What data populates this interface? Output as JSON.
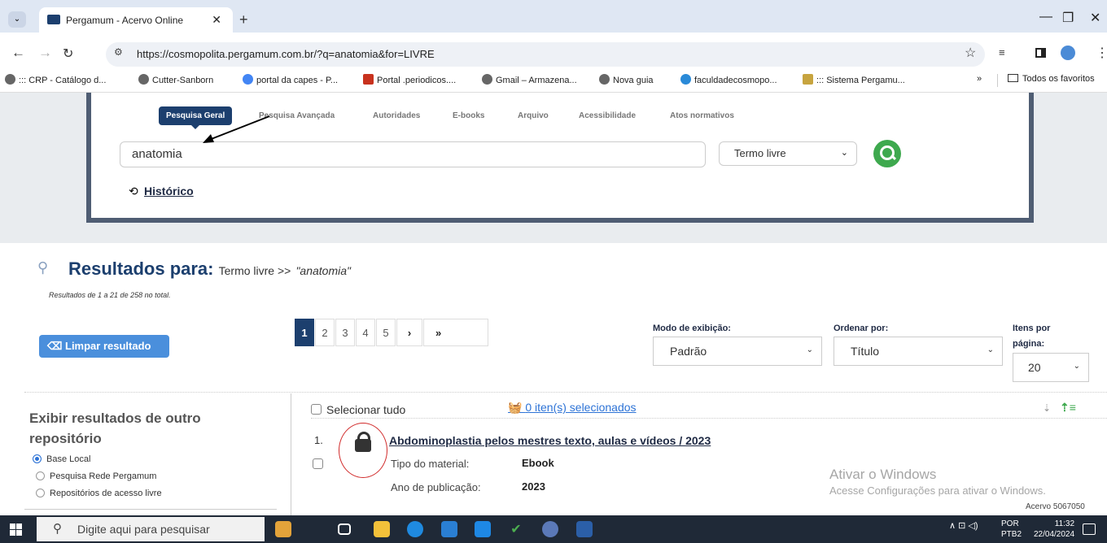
{
  "browser": {
    "tab_title": "Pergamum - Acervo Online",
    "tab_close": "✕",
    "new_tab": "+",
    "url": "https://cosmopolita.pergamum.com.br/?q=anatomia&for=LIVRE",
    "bookmarks": [
      "::: CRP - Catálogo d...",
      "Cutter-Sanborn",
      "portal da capes - P...",
      "Portal .periodicos....",
      "Gmail – Armazena...",
      "Nova guia",
      "faculdadecosmopo...",
      "::: Sistema Pergamu..."
    ],
    "bookmarks_overflow": "»",
    "all_bookmarks": "Todos os favoritos"
  },
  "search": {
    "tabs": [
      "Pesquisa Geral",
      "Pesquisa Avançada",
      "Autoridades",
      "E-books",
      "Arquivo",
      "Acessibilidade",
      "Atos normativos"
    ],
    "query": "anatomia",
    "term_select": "Termo livre",
    "history": "Histórico"
  },
  "results": {
    "heading": "Resultados para:",
    "term_label": "Termo livre >>",
    "term_query": "\"anatomia\"",
    "count_text": "Resultados de 1 a 21 de 258 no total.",
    "clear_button": "Limpar resultado",
    "pages": [
      "1",
      "2",
      "3",
      "4",
      "5",
      "›",
      "»"
    ],
    "display_mode_label": "Modo de exibição:",
    "display_mode": "Padrão",
    "order_label": "Ordenar por:",
    "order": "Título",
    "per_page_label1": "Itens por",
    "per_page_label2": "página:",
    "per_page": "20",
    "select_all": "Selecionar tudo",
    "selected_count": "0 iten(s) selecionados"
  },
  "repository": {
    "title_line1": "Exibir resultados de outro",
    "title_line2": "repositório",
    "options": [
      "Base Local",
      "Pesquisa Rede Pergamum",
      "Repositórios de acesso livre"
    ],
    "selected": "Base Local"
  },
  "record": {
    "index": "1.",
    "title": "Abdominoplastia pelos mestres texto, aulas e vídeos / 2023",
    "material_label": "Tipo do material:",
    "material": "Ebook",
    "year_label": "Ano de publicação:",
    "year": "2023",
    "acervo": "Acervo 5067050"
  },
  "watermark": {
    "line1": "Ativar o Windows",
    "line2": "Acesse Configurações para ativar o Windows."
  },
  "taskbar": {
    "search_placeholder": "Digite aqui para pesquisar",
    "lang1": "POR",
    "lang2": "PTB2",
    "time": "11:32",
    "date": "22/04/2024"
  }
}
